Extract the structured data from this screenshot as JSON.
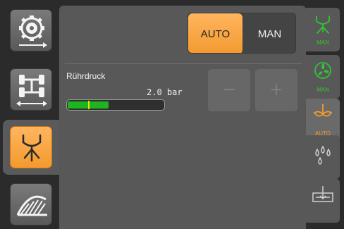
{
  "left_tabs": [
    {
      "name": "wheel-settings",
      "icon": "wheel-icon",
      "active": false
    },
    {
      "name": "track-width",
      "icon": "axle-track-icon",
      "active": false
    },
    {
      "name": "agitator",
      "icon": "agitator-spray-icon",
      "active": true
    },
    {
      "name": "boom-section",
      "icon": "spray-boom-icon",
      "active": false
    }
  ],
  "mode": {
    "auto_label": "AUTO",
    "man_label": "MAN",
    "selected": "AUTO"
  },
  "parameter": {
    "label": "Rührdruck",
    "value_text": "2.0 bar",
    "level_fraction": 0.43,
    "target_fraction": 0.22
  },
  "stepper": {
    "minus": "−",
    "plus": "+",
    "enabled": false
  },
  "right_tabs": [
    {
      "icon": "nozzle-spray-icon",
      "label": "MAN",
      "color": "#34c234"
    },
    {
      "icon": "fan-icon",
      "label": "MAN",
      "color": "#34c234"
    },
    {
      "icon": "agitator-icon",
      "label": "AUTO",
      "color": "#f39a2f"
    },
    {
      "icon": "droplets-icon",
      "label": "",
      "color": "#cfcfcf"
    },
    {
      "icon": "tank-fill-icon",
      "label": "",
      "color": "#cfcfcf"
    }
  ],
  "colors": {
    "accent": "#f39a2f",
    "active_green": "#34c234",
    "level_green": "#1fb51f",
    "target_marker": "#e8e800"
  }
}
